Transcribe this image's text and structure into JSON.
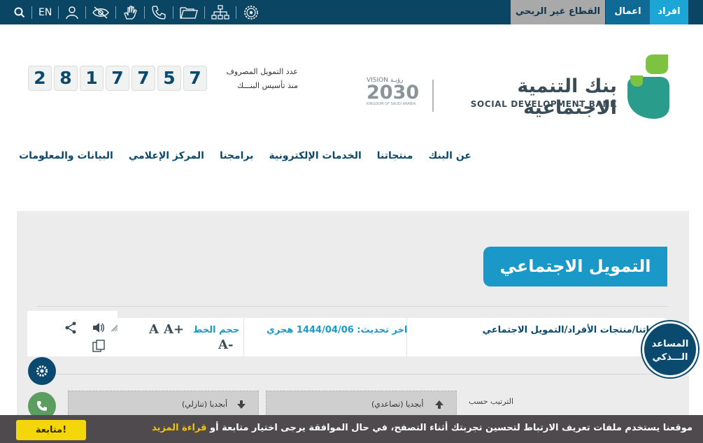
{
  "topbar": {
    "segments": [
      "افراد",
      "اعمال",
      "القطاع غير الربحي"
    ],
    "lang": "EN",
    "icons": [
      "settings-icon",
      "sitemap-icon",
      "folder-icon",
      "phone-icon",
      "sign-language-icon",
      "visibility-icon",
      "user-icon",
      "search-icon"
    ]
  },
  "counter": {
    "digits": [
      "2",
      "8",
      "1",
      "7",
      "7",
      "5",
      "7"
    ],
    "label_line1": "عدد التمويل المصروف",
    "label_line2": "منذ تأسيس البنـــك"
  },
  "header": {
    "bank_name_ar": "بنك التنمية الاجتماعية",
    "bank_name_en": "SOCIAL DEVELOPMENT BANK",
    "vision_top": "VISION رؤيـة",
    "vision_year": "2030",
    "vision_sub": "KINGDOM OF SAUDI ARABIA"
  },
  "nav": {
    "items": [
      "عن البنك",
      "منتجاتنا",
      "الخدمات الإلكترونية",
      "برامجنا",
      "المركز الإعلامي",
      "البيانات والمعلومات"
    ]
  },
  "page": {
    "title": "التمويل الاجتماعي",
    "breadcrumb": "اتنا/منتجات الأفراد/التمويل الاجتماعي",
    "last_update": "اخر تحديث: 1444/04/06 هجري",
    "font_size_label": "حجم الخط",
    "font_increase": "A+",
    "font_normal": "A",
    "font_decrease": "A-",
    "sort_by": "الترتيب حسب",
    "sort_asc": "أبجديا (تصاعدي)",
    "sort_desc": "أبجديا (تنازلي)"
  },
  "assistant": {
    "line1": "المساعد",
    "line2": "الـــذكي"
  },
  "cookie": {
    "message": "موقعنا يستخدم ملفات تعريف الارتباط لتحسين تجربتك أثناء التصفح، في حال الموافقة يرجى اختيار متابعة أو",
    "more_link": "قراءة المزيد",
    "button": "متابعة!"
  },
  "colors": {
    "topbar": "#0a4563",
    "accent": "#1a98c7",
    "cookie_button": "#f4d70a"
  }
}
